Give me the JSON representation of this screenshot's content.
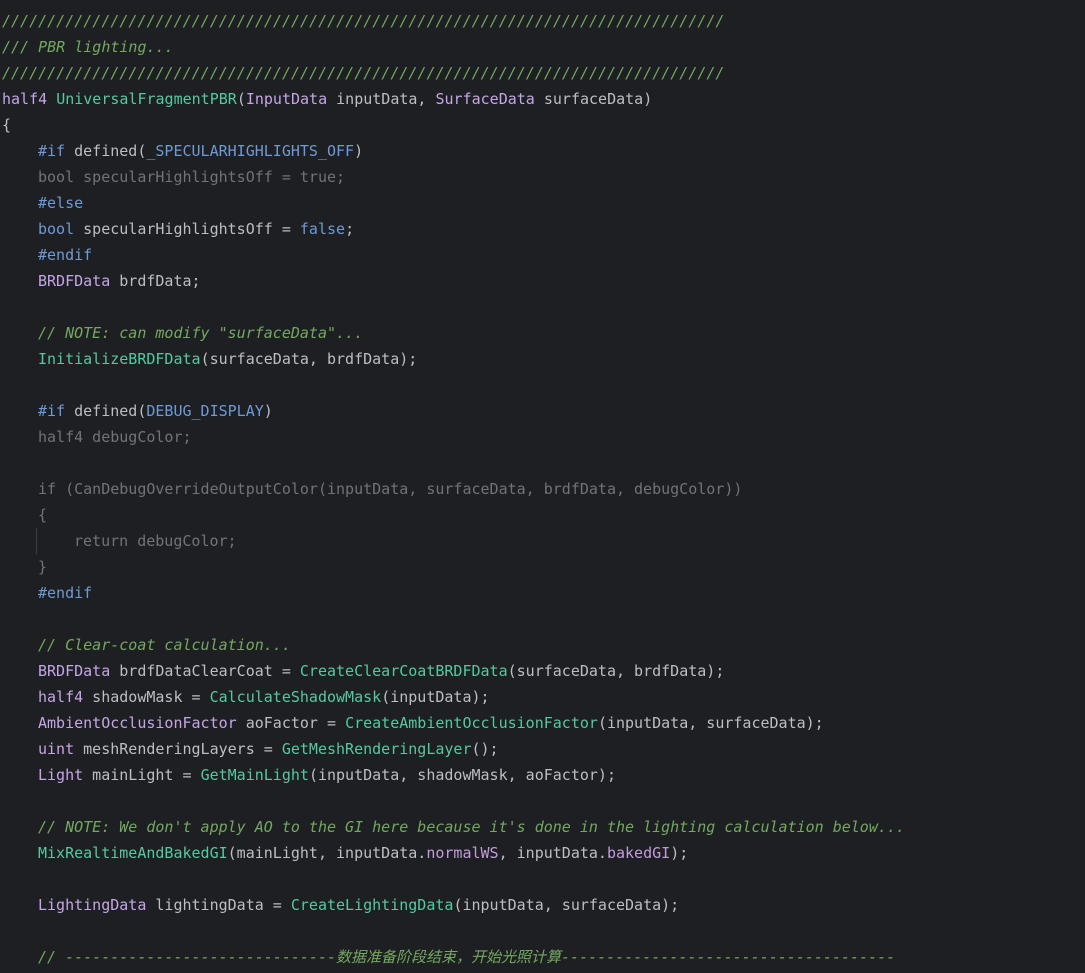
{
  "lines": [
    {
      "segments": [
        {
          "t": "////////////////////////////////////////////////////////////////////////////////",
          "c": "c-green"
        }
      ],
      "indent": 0
    },
    {
      "segments": [
        {
          "t": "/// PBR lighting...",
          "c": "c-green"
        }
      ],
      "indent": 0
    },
    {
      "segments": [
        {
          "t": "////////////////////////////////////////////////////////////////////////////////",
          "c": "c-green"
        }
      ],
      "indent": 0
    },
    {
      "segments": [
        {
          "t": "half4 ",
          "c": "c-type"
        },
        {
          "t": "UniversalFragmentPBR",
          "c": "c-func"
        },
        {
          "t": "(",
          "c": "c-def"
        },
        {
          "t": "InputData",
          "c": "c-type"
        },
        {
          "t": " inputData, ",
          "c": "c-def"
        },
        {
          "t": "SurfaceData",
          "c": "c-type"
        },
        {
          "t": " surfaceData)",
          "c": "c-def"
        }
      ],
      "indent": 0
    },
    {
      "segments": [
        {
          "t": "{",
          "c": "c-def"
        }
      ],
      "indent": 0
    },
    {
      "segments": [
        {
          "t": "#if",
          "c": "c-macro"
        },
        {
          "t": " defined(",
          "c": "c-def"
        },
        {
          "t": "_SPECULARHIGHLIGHTS_OFF",
          "c": "c-macro"
        },
        {
          "t": ")",
          "c": "c-def"
        }
      ],
      "indent": 1
    },
    {
      "segments": [
        {
          "t": "bool specularHighlightsOff = true;",
          "c": "c-inactive"
        }
      ],
      "indent": 1
    },
    {
      "segments": [
        {
          "t": "#else",
          "c": "c-macro"
        }
      ],
      "indent": 1
    },
    {
      "segments": [
        {
          "t": "bool",
          "c": "c-macro"
        },
        {
          "t": " specularHighlightsOff = ",
          "c": "c-def"
        },
        {
          "t": "false",
          "c": "c-macro"
        },
        {
          "t": ";",
          "c": "c-def"
        }
      ],
      "indent": 1
    },
    {
      "segments": [
        {
          "t": "#endif",
          "c": "c-macro"
        }
      ],
      "indent": 1
    },
    {
      "segments": [
        {
          "t": "BRDFData",
          "c": "c-type"
        },
        {
          "t": " brdfData;",
          "c": "c-def"
        }
      ],
      "indent": 1
    },
    {
      "segments": [],
      "indent": 0
    },
    {
      "segments": [
        {
          "t": "// NOTE: can modify \"surfaceData\"...",
          "c": "c-green"
        }
      ],
      "indent": 1
    },
    {
      "segments": [
        {
          "t": "InitializeBRDFData",
          "c": "c-func"
        },
        {
          "t": "(surfaceData, brdfData);",
          "c": "c-def"
        }
      ],
      "indent": 1
    },
    {
      "segments": [],
      "indent": 0
    },
    {
      "segments": [
        {
          "t": "#if",
          "c": "c-macro"
        },
        {
          "t": " defined(",
          "c": "c-def"
        },
        {
          "t": "DEBUG_DISPLAY",
          "c": "c-macro"
        },
        {
          "t": ")",
          "c": "c-def"
        }
      ],
      "indent": 1
    },
    {
      "segments": [
        {
          "t": "half4 debugColor;",
          "c": "c-inactive"
        }
      ],
      "indent": 1
    },
    {
      "segments": [],
      "indent": 0
    },
    {
      "segments": [
        {
          "t": "if (CanDebugOverrideOutputColor(inputData, surfaceData, brdfData, debugColor))",
          "c": "c-inactive"
        }
      ],
      "indent": 1
    },
    {
      "segments": [
        {
          "t": "{",
          "c": "c-inactive"
        }
      ],
      "indent": 1
    },
    {
      "segments": [
        {
          "t": "return debugColor;",
          "c": "c-inactive"
        }
      ],
      "indent": 2
    },
    {
      "segments": [
        {
          "t": "}",
          "c": "c-inactive"
        }
      ],
      "indent": 1
    },
    {
      "segments": [
        {
          "t": "#endif",
          "c": "c-macro"
        }
      ],
      "indent": 1
    },
    {
      "segments": [],
      "indent": 0
    },
    {
      "segments": [
        {
          "t": "// Clear-coat calculation...",
          "c": "c-green"
        }
      ],
      "indent": 1
    },
    {
      "segments": [
        {
          "t": "BRDFData",
          "c": "c-type"
        },
        {
          "t": " brdfDataClearCoat = ",
          "c": "c-def"
        },
        {
          "t": "CreateClearCoatBRDFData",
          "c": "c-func"
        },
        {
          "t": "(surfaceData, brdfData);",
          "c": "c-def"
        }
      ],
      "indent": 1
    },
    {
      "segments": [
        {
          "t": "half4",
          "c": "c-type"
        },
        {
          "t": " shadowMask = ",
          "c": "c-def"
        },
        {
          "t": "CalculateShadowMask",
          "c": "c-func"
        },
        {
          "t": "(inputData);",
          "c": "c-def"
        }
      ],
      "indent": 1
    },
    {
      "segments": [
        {
          "t": "AmbientOcclusionFactor",
          "c": "c-type"
        },
        {
          "t": " aoFactor = ",
          "c": "c-def"
        },
        {
          "t": "CreateAmbientOcclusionFactor",
          "c": "c-func"
        },
        {
          "t": "(inputData, surfaceData);",
          "c": "c-def"
        }
      ],
      "indent": 1
    },
    {
      "segments": [
        {
          "t": "uint",
          "c": "c-type"
        },
        {
          "t": " meshRenderingLayers = ",
          "c": "c-def"
        },
        {
          "t": "GetMeshRenderingLayer",
          "c": "c-func"
        },
        {
          "t": "();",
          "c": "c-def"
        }
      ],
      "indent": 1
    },
    {
      "segments": [
        {
          "t": "Light",
          "c": "c-type"
        },
        {
          "t": " mainLight = ",
          "c": "c-def"
        },
        {
          "t": "GetMainLight",
          "c": "c-func"
        },
        {
          "t": "(inputData, shadowMask, aoFactor);",
          "c": "c-def"
        }
      ],
      "indent": 1
    },
    {
      "segments": [],
      "indent": 0
    },
    {
      "segments": [
        {
          "t": "// NOTE: We don't apply AO to the GI here because it's done in the lighting calculation below...",
          "c": "c-green"
        }
      ],
      "indent": 1
    },
    {
      "segments": [
        {
          "t": "MixRealtimeAndBakedGI",
          "c": "c-func"
        },
        {
          "t": "(mainLight, inputData.",
          "c": "c-def"
        },
        {
          "t": "normalWS",
          "c": "c-field"
        },
        {
          "t": ", inputData.",
          "c": "c-def"
        },
        {
          "t": "bakedGI",
          "c": "c-field"
        },
        {
          "t": ");",
          "c": "c-def"
        }
      ],
      "indent": 1
    },
    {
      "segments": [],
      "indent": 0
    },
    {
      "segments": [
        {
          "t": "LightingData",
          "c": "c-type"
        },
        {
          "t": " lightingData = ",
          "c": "c-def"
        },
        {
          "t": "CreateLightingData",
          "c": "c-func"
        },
        {
          "t": "(inputData, surfaceData);",
          "c": "c-def"
        }
      ],
      "indent": 1
    },
    {
      "segments": [],
      "indent": 0
    },
    {
      "segments": [
        {
          "t": "// ------------------------------数据准备阶段结束，开始光照计算-------------------------------------",
          "c": "c-green"
        }
      ],
      "indent": 1
    }
  ]
}
